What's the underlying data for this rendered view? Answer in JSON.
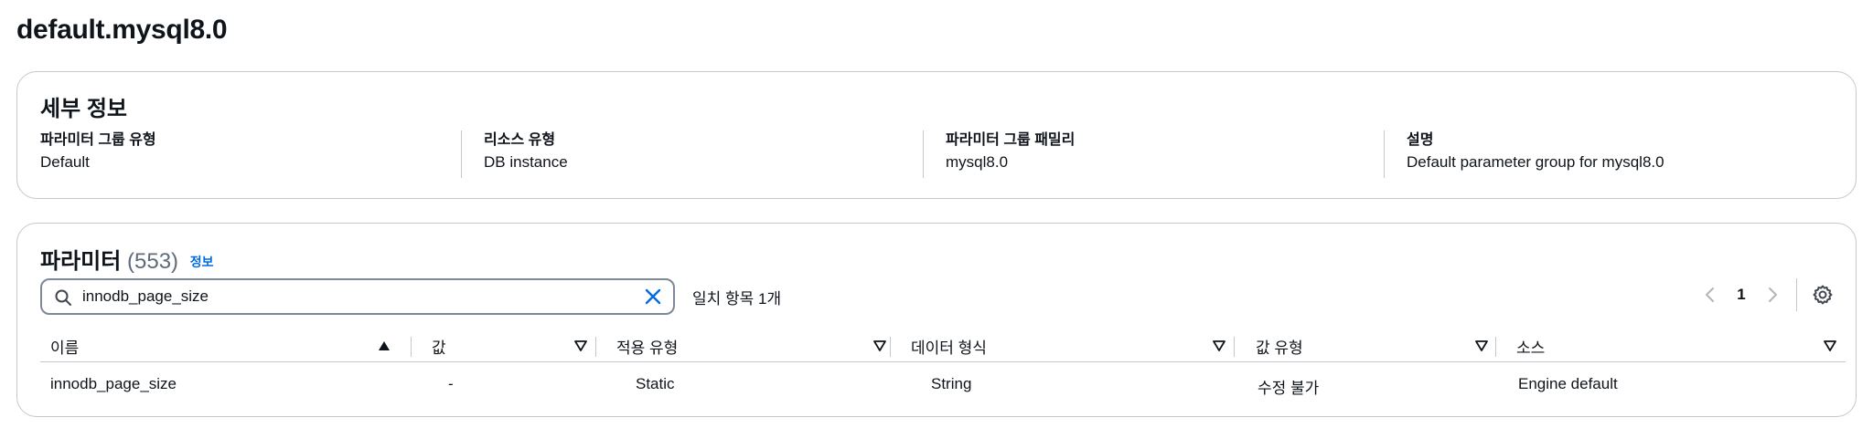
{
  "page": {
    "title": "default.mysql8.0"
  },
  "details": {
    "heading": "세부 정보",
    "fields": [
      {
        "label": "파라미터 그룹 유형",
        "value": "Default"
      },
      {
        "label": "리소스 유형",
        "value": "DB instance"
      },
      {
        "label": "파라미터 그룹 패밀리",
        "value": "mysql8.0"
      },
      {
        "label": "설명",
        "value": "Default parameter group for mysql8.0"
      }
    ]
  },
  "parameters": {
    "heading": "파라미터",
    "count": "(553)",
    "info_link": "정보",
    "search": {
      "value": "innodb_page_size",
      "placeholder": ""
    },
    "match_text": "일치 항목 1개",
    "pagination": {
      "current_page": "1"
    },
    "columns": [
      "이름",
      "값",
      "적용 유형",
      "데이터 형식",
      "값 유형",
      "소스"
    ],
    "rows": [
      {
        "name": "innodb_page_size",
        "value": "-",
        "apply_type": "Static",
        "data_type": "String",
        "value_type": "수정 불가",
        "source": "Engine default"
      }
    ]
  },
  "colors": {
    "link": "#006ce0",
    "border": "#c6c6cd",
    "text": "#0f141a",
    "muted": "#5f6b7a"
  },
  "icons": [
    "search-icon",
    "close-icon",
    "chevron-left-icon",
    "chevron-right-icon",
    "gear-icon",
    "sort-ascending-icon",
    "sort-descending-icon"
  ]
}
